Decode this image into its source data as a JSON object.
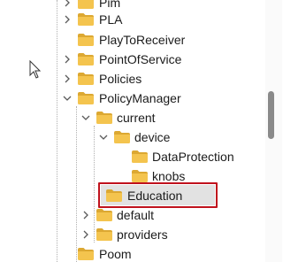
{
  "tree": {
    "items": [
      {
        "label": "Pim",
        "expandable": true,
        "expanded": false
      },
      {
        "label": "PLA",
        "expandable": true,
        "expanded": false
      },
      {
        "label": "PlayToReceiver",
        "expandable": false,
        "expanded": false
      },
      {
        "label": "PointOfService",
        "expandable": true,
        "expanded": false
      },
      {
        "label": "Policies",
        "expandable": true,
        "expanded": false
      },
      {
        "label": "PolicyManager",
        "expandable": true,
        "expanded": true
      },
      {
        "label": "current",
        "expandable": true,
        "expanded": true
      },
      {
        "label": "device",
        "expandable": true,
        "expanded": true
      },
      {
        "label": "DataProtection",
        "expandable": false,
        "expanded": false
      },
      {
        "label": "knobs",
        "expandable": false,
        "expanded": false
      },
      {
        "label": "Education",
        "expandable": false,
        "expanded": false,
        "selected": true
      },
      {
        "label": "default",
        "expandable": true,
        "expanded": false
      },
      {
        "label": "providers",
        "expandable": true,
        "expanded": false
      },
      {
        "label": "Poom",
        "expandable": false,
        "expanded": false
      }
    ]
  },
  "colors": {
    "folder": "#f4c44e",
    "folder_dark": "#dca832",
    "highlight_border": "#c0121d",
    "selection": "#e2e2e2",
    "text": "#1b1b1b"
  }
}
